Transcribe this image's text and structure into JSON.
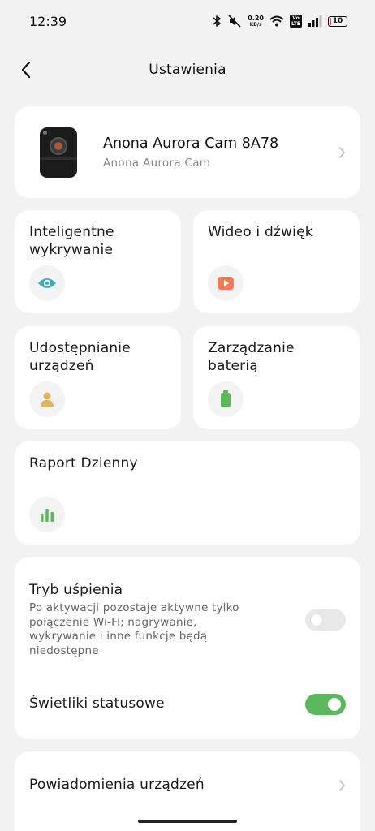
{
  "status_bar": {
    "time": "12:39",
    "net_speed_value": "0.20",
    "net_speed_unit": "KB/s",
    "volte_top": "Vo",
    "volte_bottom": "LTE",
    "battery_level": "10",
    "icons": [
      "bluetooth-icon",
      "mute-icon",
      "wifi-icon",
      "signal-icon",
      "battery-icon"
    ]
  },
  "header": {
    "title": "Ustawienia",
    "back_icon": "chevron-left-icon"
  },
  "device": {
    "name": "Anona Aurora Cam 8A78",
    "model": "Anona Aurora Cam"
  },
  "tiles": [
    {
      "label_line1": "Inteligentne",
      "label_line2": "wykrywanie",
      "icon": "eye-icon",
      "icon_color": "#3fa8c0"
    },
    {
      "label_line1": "Wideo i dźwięk",
      "label_line2": "",
      "icon": "video-play-icon",
      "icon_color": "#f07b5c"
    },
    {
      "label_line1": "Udostępnianie",
      "label_line2": "urządzeń",
      "icon": "person-icon",
      "icon_color": "#e0b45e"
    },
    {
      "label_line1": "Zarządzanie",
      "label_line2": "baterią",
      "icon": "battery-icon",
      "icon_color": "#5cb85c"
    }
  ],
  "report": {
    "label": "Raport Dzienny",
    "icon": "bar-chart-icon",
    "icon_color": "#5cb85c"
  },
  "settings": {
    "sleep_mode": {
      "title": "Tryb uśpienia",
      "description": "Po aktywacji pozostaje aktywne tylko połączenie Wi-Fi; nagrywanie, wykrywanie i inne funkcje będą niedostępne",
      "enabled": false
    },
    "status_lights": {
      "title": "Świetliki statusowe",
      "enabled": true
    }
  },
  "notifications": {
    "label": "Powiadomienia urządzeń"
  },
  "colors": {
    "accent_green": "#5cb85c",
    "background": "#f2f2f2",
    "card": "#ffffff"
  }
}
